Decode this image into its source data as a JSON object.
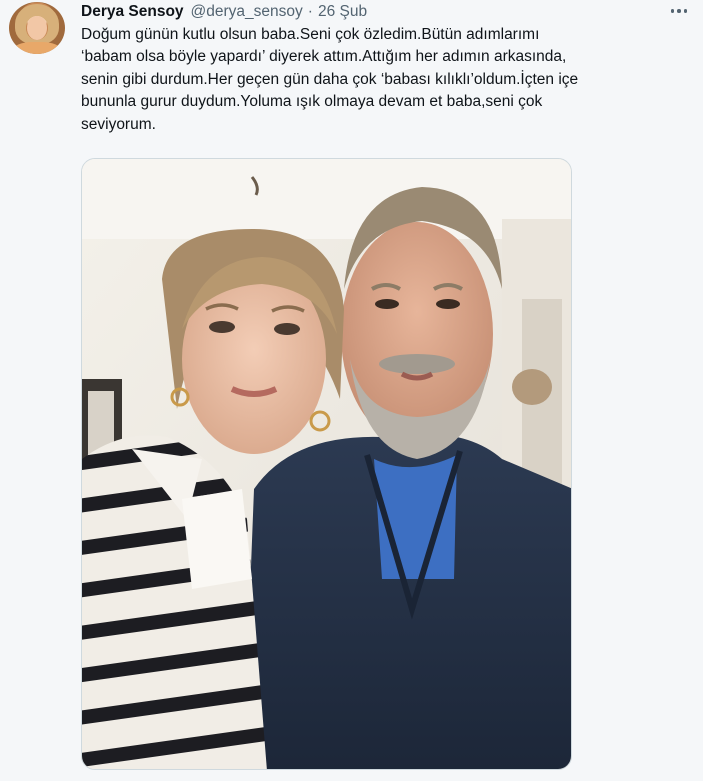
{
  "tweet": {
    "author": {
      "display_name": "Derya Sensoy",
      "handle": "@derya_sensoy",
      "separator": "·",
      "date": "26 Şub"
    },
    "text_lines": [
      "Doğum günün kutlu olsun baba.Seni çok özledim.Bütün adımlarımı",
      "‘babam olsa böyle yapardı’ diyerek attım.Attığım her adımın arkasında,",
      "senin gibi durdum.Her geçen gün daha çok ‘babası kılıklı’oldum.İçten içe",
      "bununla gurur duydum.Yoluma ışık olmaya devam et baba,seni çok",
      "seviyorum."
    ],
    "more_icon": "more-dots-icon",
    "photo": {
      "subject": "selfie-photo"
    }
  },
  "colors": {
    "text": "#0f1419",
    "secondary_text": "#536471",
    "background": "#f5f7f9",
    "border": "#cfd9de"
  }
}
